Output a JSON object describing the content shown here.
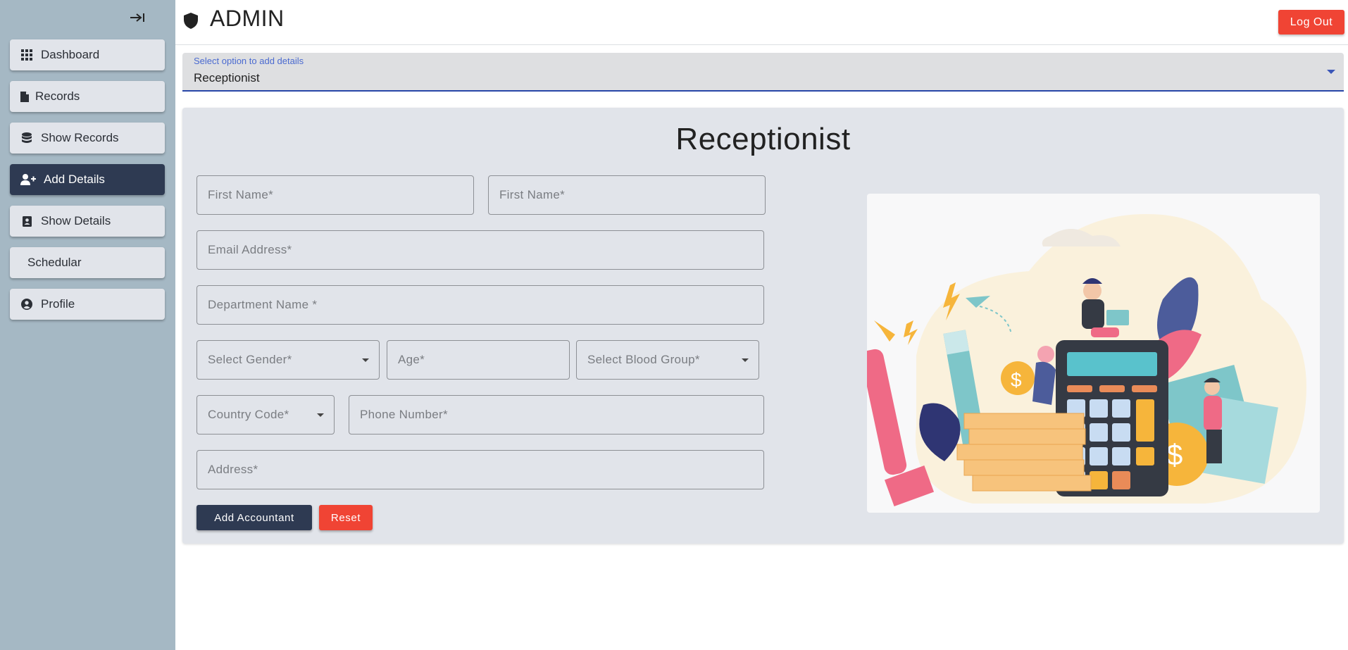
{
  "sidebar": {
    "items": [
      {
        "label": "Dashboard",
        "icon": "grid-icon"
      },
      {
        "label": "Records",
        "icon": "file-icon"
      },
      {
        "label": "Show Records",
        "icon": "database-icon"
      },
      {
        "label": "Add Details",
        "icon": "add-user-icon",
        "active": true
      },
      {
        "label": "Show Details",
        "icon": "contact-card-icon"
      },
      {
        "label": "Schedular",
        "icon": ""
      },
      {
        "label": "Profile",
        "icon": "user-circle-icon"
      }
    ]
  },
  "header": {
    "title": "ADMIN",
    "logout_label": "Log Out"
  },
  "option_select": {
    "label": "Select option to add details",
    "value": "Receptionist"
  },
  "form": {
    "title": "Receptionist",
    "first_name_1": "First Name*",
    "first_name_2": "First Name*",
    "email": "Email Address*",
    "department": "Department Name *",
    "gender": "Select Gender*",
    "age": "Age*",
    "blood_group": "Select Blood Group*",
    "country_code": "Country Code*",
    "phone": "Phone Number*",
    "address": "Address*",
    "submit_label": "Add Accountant",
    "reset_label": "Reset"
  },
  "colors": {
    "accent_dark": "#2e3a52",
    "danger": "#f04434",
    "sidebar_bg": "#a5b8c4",
    "panel_bg": "#e1e4ea"
  }
}
